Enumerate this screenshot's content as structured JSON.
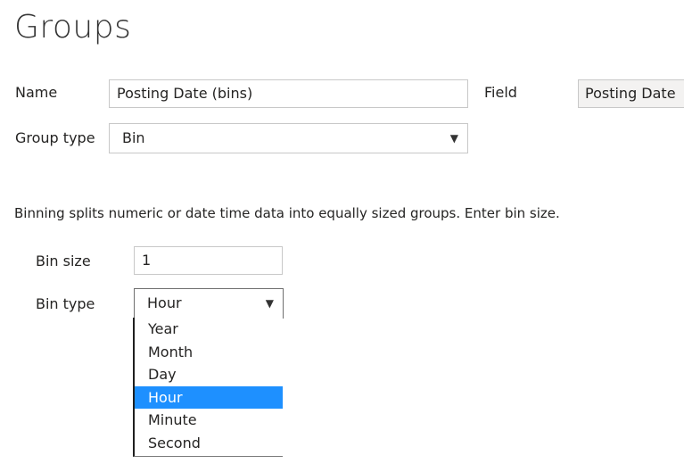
{
  "page": {
    "title": "Groups"
  },
  "form": {
    "name_label": "Name",
    "name_value": "Posting Date (bins)",
    "field_label": "Field",
    "field_value": "Posting Date",
    "group_type_label": "Group type",
    "group_type_value": "Bin",
    "description": "Binning splits numeric or date time data into equally sized groups. Enter bin size.",
    "bin_size_label": "Bin size",
    "bin_size_value": "1",
    "bin_type_label": "Bin type",
    "bin_type_value": "Hour"
  },
  "bin_type_options": [
    "Year",
    "Month",
    "Day",
    "Hour",
    "Minute",
    "Second"
  ],
  "icons": {
    "dropdown_caret": "▼"
  },
  "colors": {
    "selected_highlight": "#1e90ff"
  }
}
